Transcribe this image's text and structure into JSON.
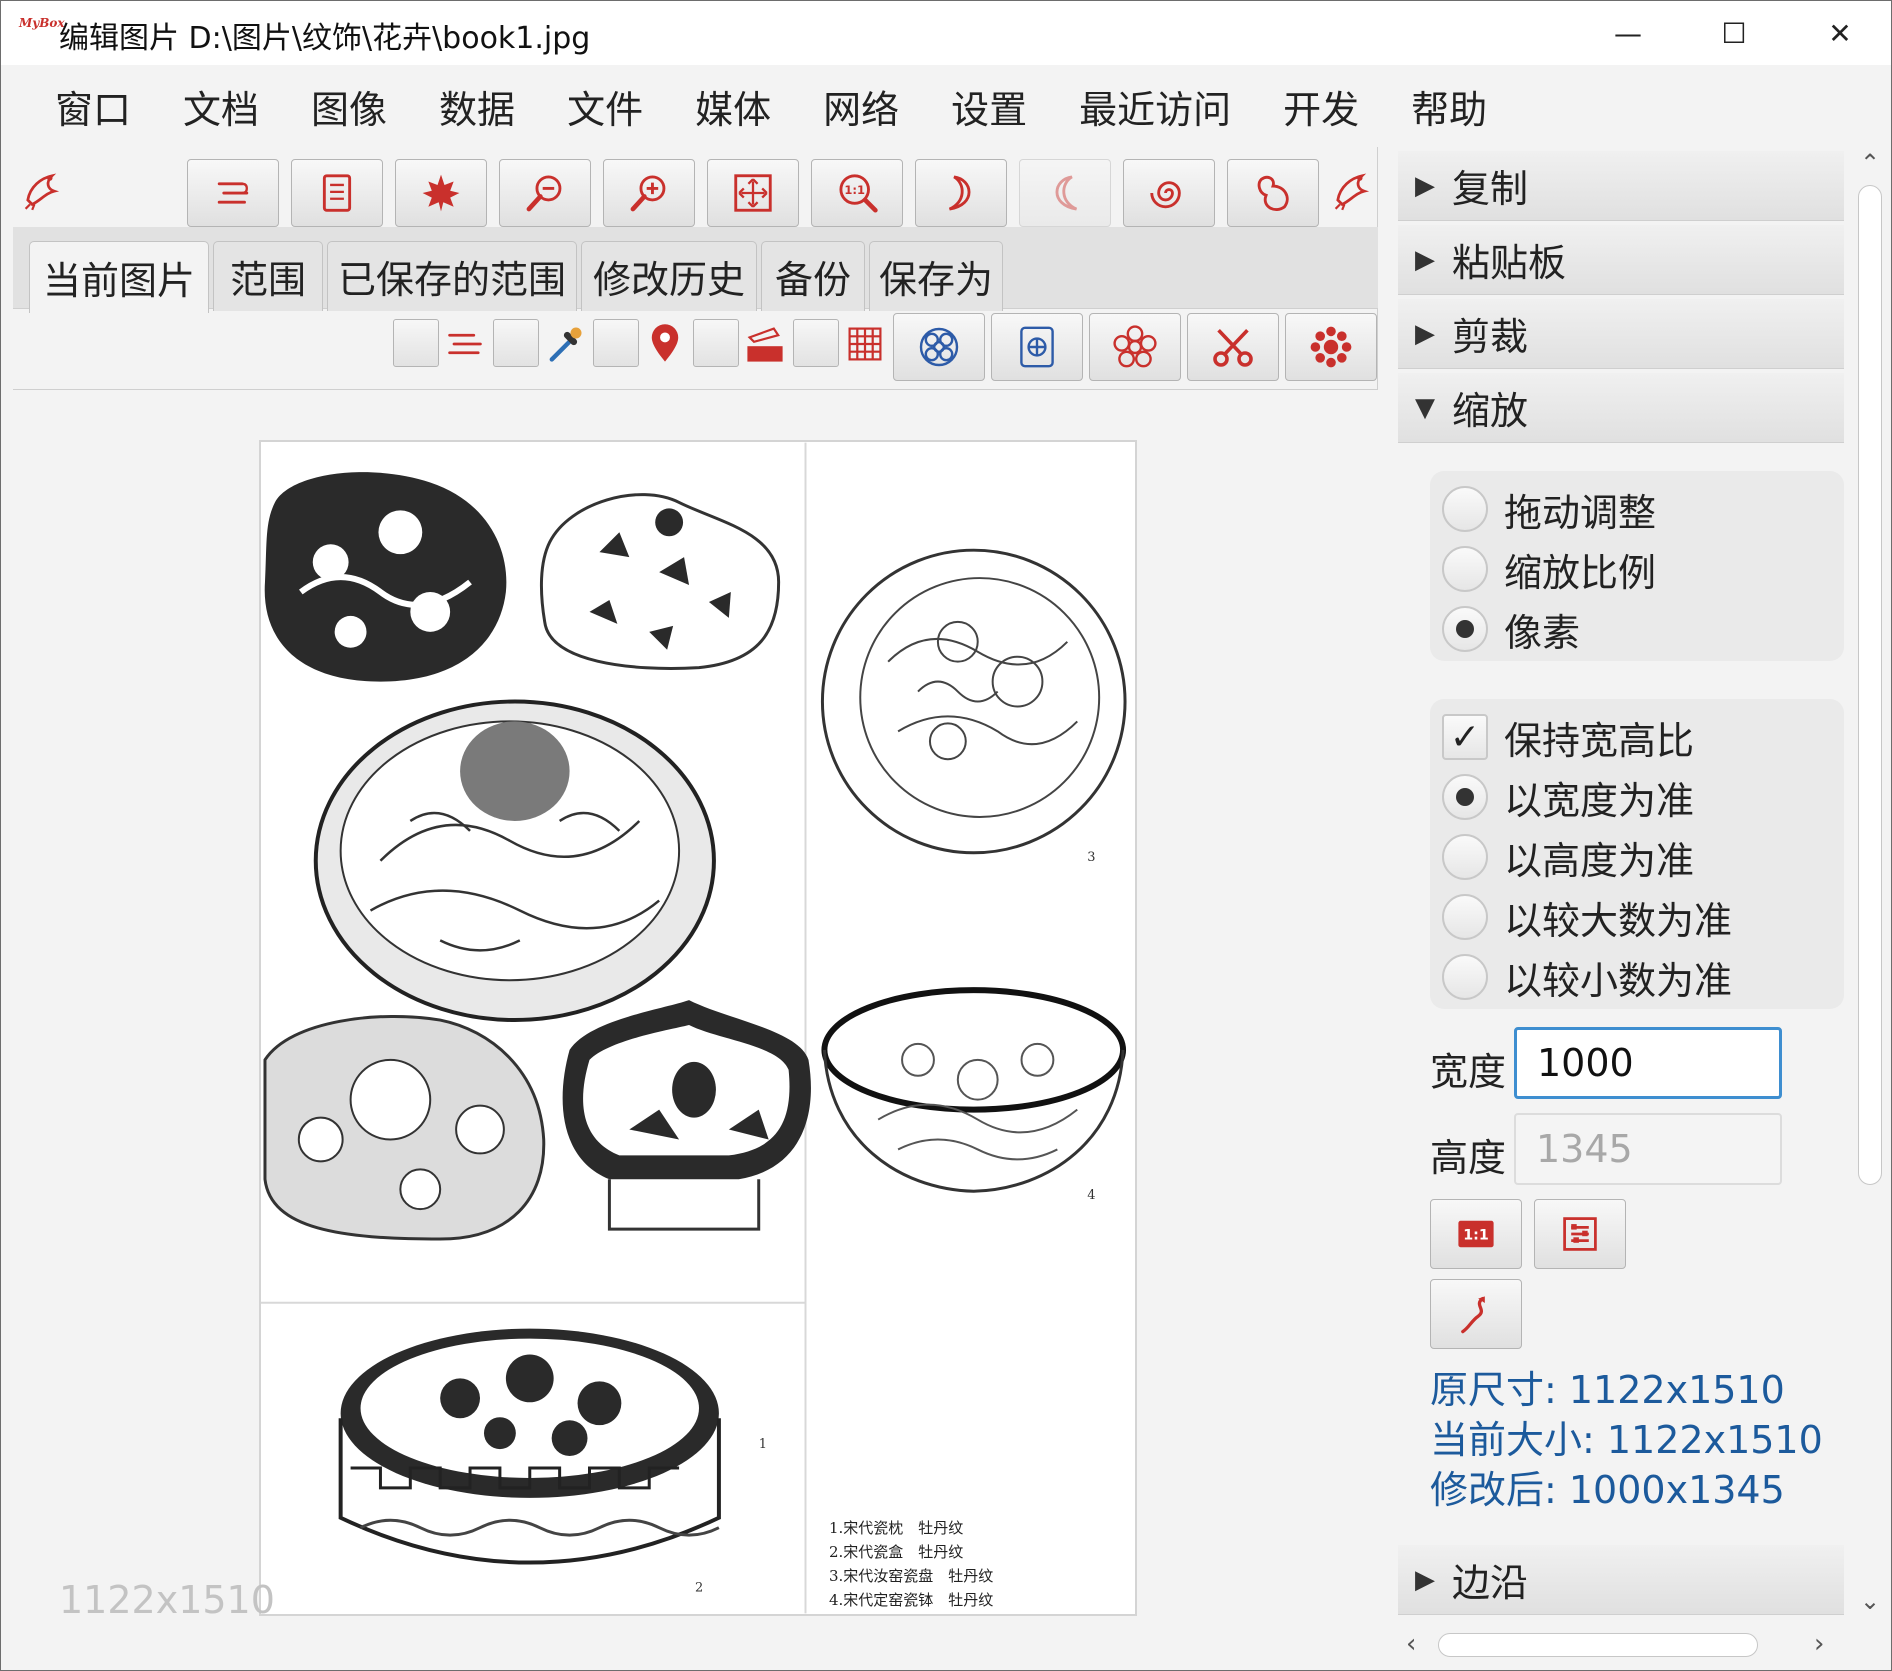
{
  "window": {
    "app_logo": "MyBox",
    "title": "编辑图片 D:\\图片\\纹饰\\花卉\\book1.jpg",
    "minimize_symbol": "—",
    "maximize_symbol": "☐",
    "close_symbol": "✕"
  },
  "menu": [
    "窗口",
    "文档",
    "图像",
    "数据",
    "文件",
    "媒体",
    "网络",
    "设置",
    "最近访问",
    "开发",
    "帮助"
  ],
  "toolbar": {
    "icons": [
      "undo-lines-icon",
      "document-icon",
      "maple-leaf-icon",
      "zoom-out-icon",
      "zoom-in-icon",
      "fit-window-icon",
      "zoom-actual-icon",
      "rotate-left-icon",
      "rotate-right-icon",
      "spiral-icon",
      "pop-icon"
    ],
    "deco_icon": "phoenix-icon"
  },
  "tabs": [
    "当前图片",
    "范围",
    "已保存的范围",
    "修改历史",
    "备份",
    "保存为"
  ],
  "active_tab": "当前图片",
  "sub_toolbar": {
    "icons": [
      "lines-icon",
      "eyedropper-icon",
      "location-pin-icon",
      "fill-bar-icon",
      "grid-icon"
    ],
    "buttons": [
      "cells-icon",
      "frame-icon",
      "flower-icon",
      "scissors-icon",
      "chrysanthemum-icon"
    ]
  },
  "canvas": {
    "image_label": "1122x1510",
    "caption_lines": [
      "1.宋代瓷枕　牡丹纹",
      "2.宋代瓷盒　牡丹纹",
      "3.宋代汝窑瓷盘　牡丹纹",
      "4.宋代定窑瓷钵　牡丹纹"
    ],
    "figure_numbers": [
      "1",
      "2",
      "3",
      "4"
    ]
  },
  "right_panel": {
    "accordion": [
      {
        "label": "复制",
        "expanded": false
      },
      {
        "label": "粘贴板",
        "expanded": false
      },
      {
        "label": "剪裁",
        "expanded": false
      },
      {
        "label": "缩放",
        "expanded": true
      },
      {
        "label": "边沿",
        "expanded": false
      }
    ],
    "scale_mode": {
      "options": [
        "拖动调整",
        "缩放比例",
        "像素"
      ],
      "selected": "像素"
    },
    "keep_ratio": {
      "label": "保持宽高比",
      "checked": true,
      "check_mark": "✓",
      "options": [
        "以宽度为准",
        "以高度为准",
        "以较大数为准",
        "以较小数为准"
      ],
      "selected": "以宽度为准"
    },
    "width_label": "宽度",
    "width_value": "1000",
    "height_label": "高度",
    "height_value": "1345",
    "info": {
      "original": "原尺寸: 1122x1510",
      "current": "当前大小: 1122x1510",
      "modified": "修改后: 1000x1345"
    }
  },
  "colors": {
    "accent": "#c9302c",
    "info_text": "#1c5a9c",
    "focus_border": "#3e8ed0",
    "window_bg": "#f3f3f3"
  }
}
